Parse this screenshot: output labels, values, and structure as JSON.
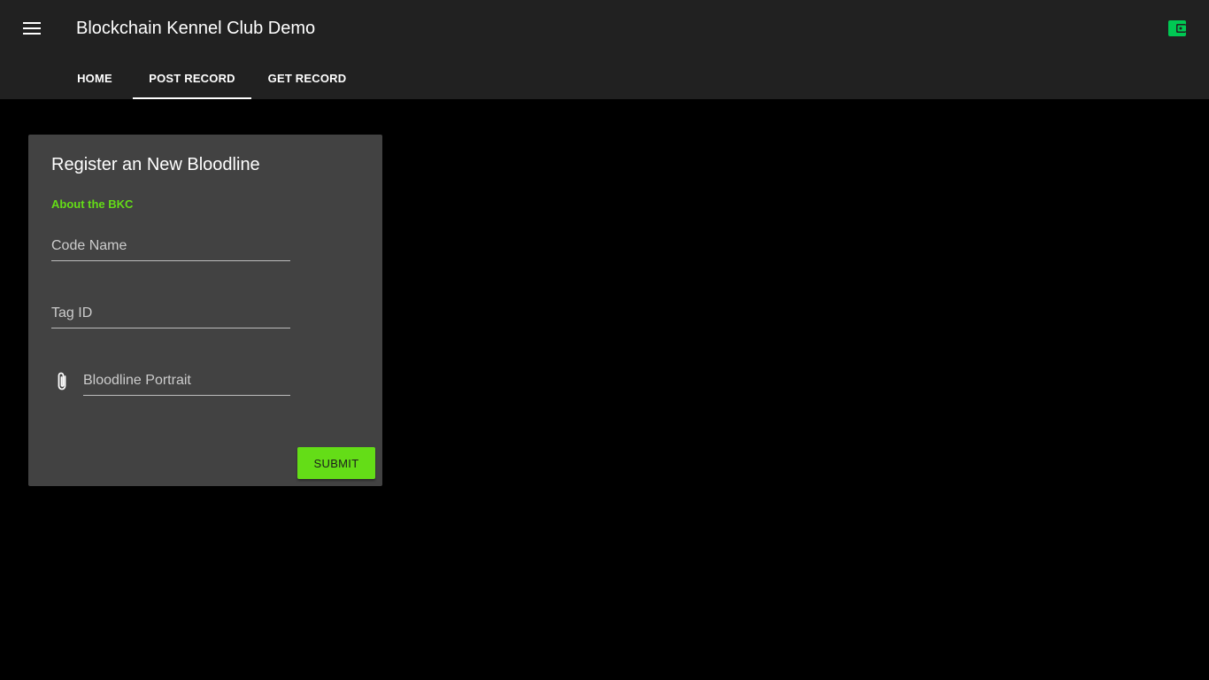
{
  "colors": {
    "appbar": "#212121",
    "background": "#000000",
    "card": "#424242",
    "accent": "#64dd17",
    "wallet_icon": "#00c853"
  },
  "header": {
    "menu_icon": "hamburger-menu-icon",
    "title": "Blockchain Kennel Club Demo",
    "wallet_icon": "wallet-icon"
  },
  "tabs": [
    {
      "label": "HOME",
      "active": false
    },
    {
      "label": "POST RECORD",
      "active": true
    },
    {
      "label": "GET RECORD",
      "active": false
    }
  ],
  "form": {
    "title": "Register an New Bloodline",
    "about_link": "About the BKC",
    "code_name_placeholder": "Code Name",
    "tag_id_placeholder": "Tag ID",
    "portrait_icon": "paperclip-icon",
    "portrait_placeholder": "Bloodline Portrait",
    "submit_label": "SUBMIT"
  }
}
